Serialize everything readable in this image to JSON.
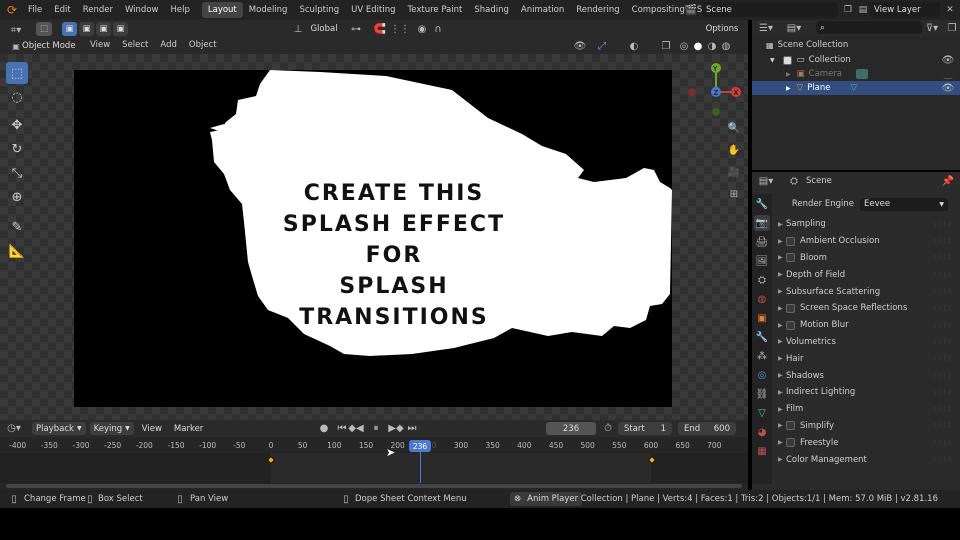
{
  "topbar": {
    "menus": [
      "File",
      "Edit",
      "Render",
      "Window",
      "Help"
    ],
    "workspaces": [
      "Layout",
      "Modeling",
      "Sculpting",
      "UV Editing",
      "Texture Paint",
      "Shading",
      "Animation",
      "Rendering",
      "Compositing",
      "Scripting"
    ],
    "active_workspace": "Layout",
    "scene": "Scene",
    "view_layer": "View Layer"
  },
  "viewport_header": {
    "orientation": "Global",
    "options": "Options",
    "mode": "Object Mode",
    "menus": [
      "View",
      "Select",
      "Add",
      "Object"
    ]
  },
  "viewport": {
    "text_lines": [
      "CREATE THIS",
      "SPLASH EFFECT",
      "FOR",
      "SPLASH",
      "TRANSITIONS"
    ]
  },
  "outliner": {
    "title": "Scene Collection",
    "items": [
      {
        "label": "Collection"
      },
      {
        "label": "Camera"
      },
      {
        "label": "Plane"
      }
    ]
  },
  "properties": {
    "scene": "Scene",
    "render_engine_label": "Render Engine",
    "render_engine": "Eevee",
    "panels": [
      {
        "label": "Sampling",
        "check": false
      },
      {
        "label": "Ambient Occlusion",
        "check": true
      },
      {
        "label": "Bloom",
        "check": true
      },
      {
        "label": "Depth of Field",
        "check": false
      },
      {
        "label": "Subsurface Scattering",
        "check": false
      },
      {
        "label": "Screen Space Reflections",
        "check": true
      },
      {
        "label": "Motion Blur",
        "check": true
      },
      {
        "label": "Volumetrics",
        "check": false
      },
      {
        "label": "Hair",
        "check": false
      },
      {
        "label": "Shadows",
        "check": false
      },
      {
        "label": "Indirect Lighting",
        "check": false
      },
      {
        "label": "Film",
        "check": false
      },
      {
        "label": "Simplify",
        "check": true
      },
      {
        "label": "Freestyle",
        "check": true
      },
      {
        "label": "Color Management",
        "check": false
      }
    ]
  },
  "timeline": {
    "menus": [
      "Playback",
      "Keying",
      "View",
      "Marker"
    ],
    "current_frame": "236",
    "start_label": "Start",
    "start": "1",
    "end_label": "End",
    "end": "600",
    "ticks": [
      "-400",
      "-350",
      "-300",
      "-250",
      "-200",
      "-150",
      "-100",
      "-50",
      "0",
      "50",
      "100",
      "150",
      "200",
      "250",
      "300",
      "350",
      "400",
      "450",
      "500",
      "550",
      "600",
      "650",
      "700"
    ]
  },
  "statusbar": {
    "items": [
      "Change Frame",
      "Box Select",
      "Pan View",
      "Dope Sheet Context Menu",
      "Anim Player"
    ],
    "info": "Collection | Plane | Verts:4 | Faces:1 | Tris:2 | Objects:1/1 | Mem: 57.0 MiB | v2.81.16"
  }
}
